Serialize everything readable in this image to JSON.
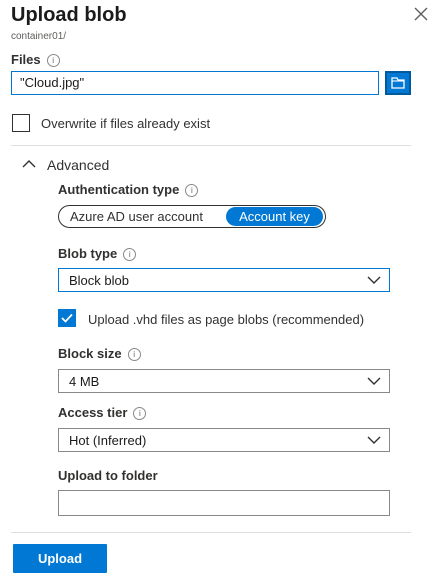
{
  "panel": {
    "title": "Upload blob",
    "subtitle": "container01/"
  },
  "files": {
    "label": "Files",
    "value": "\"Cloud.jpg\""
  },
  "overwrite": {
    "label": "Overwrite if files already exist",
    "checked": false
  },
  "advanced": {
    "label": "Advanced",
    "expanded": true
  },
  "auth": {
    "label": "Authentication type",
    "options": [
      "Azure AD user account",
      "Account key"
    ],
    "selected": "Account key"
  },
  "blob_type": {
    "label": "Blob type",
    "value": "Block blob"
  },
  "upload_vhd": {
    "label": "Upload .vhd files as page blobs (recommended)",
    "checked": true
  },
  "block_size": {
    "label": "Block size",
    "value": "4 MB"
  },
  "access_tier": {
    "label": "Access tier",
    "value": "Hot (Inferred)"
  },
  "upload_folder": {
    "label": "Upload to folder",
    "value": ""
  },
  "actions": {
    "upload_label": "Upload"
  },
  "colors": {
    "accent": "#0078d4",
    "text": "#323130",
    "border": "#8a8886"
  }
}
